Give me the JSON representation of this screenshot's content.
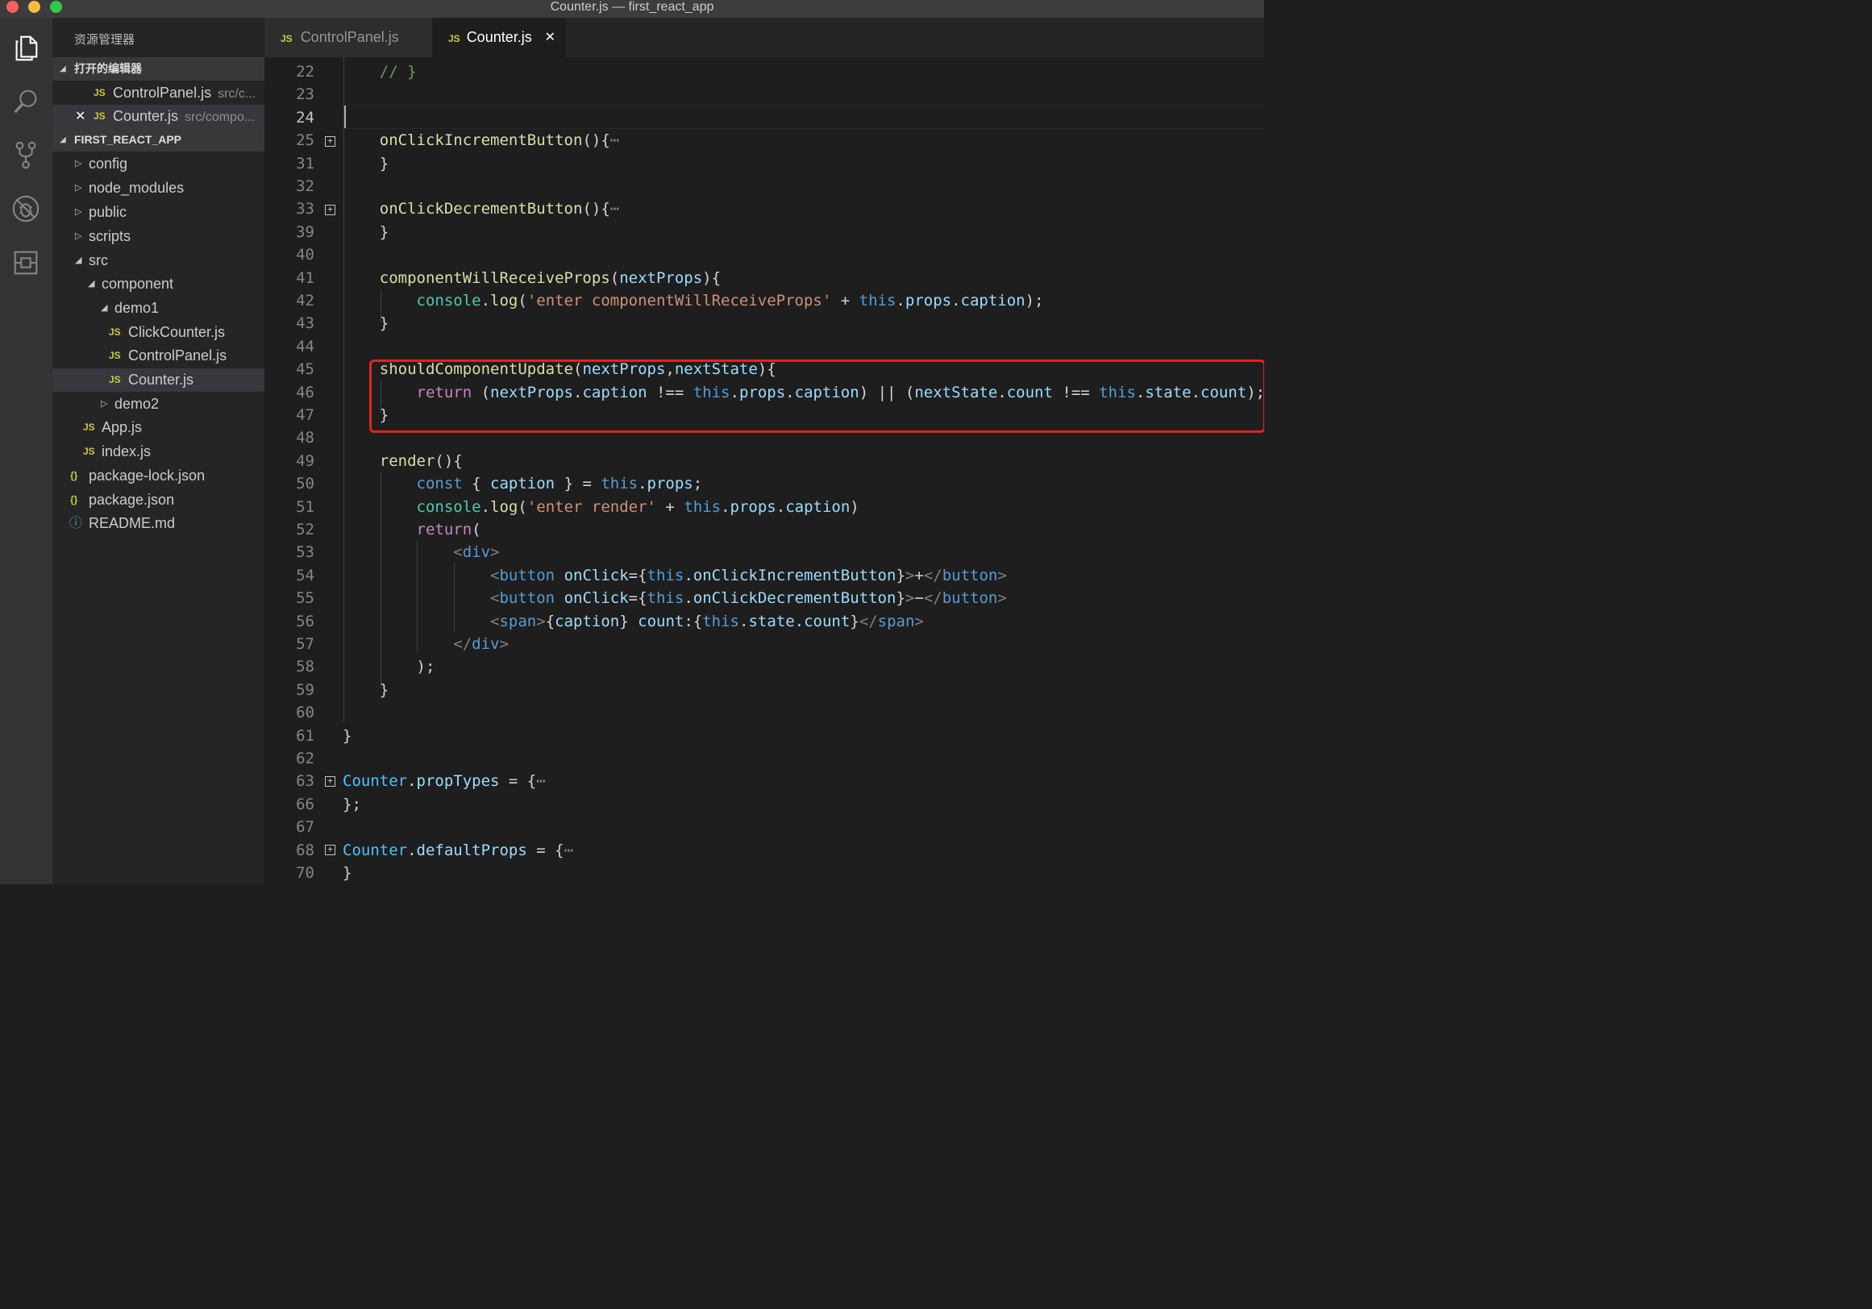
{
  "window": {
    "title": "Counter.js — first_react_app"
  },
  "activity_bar": [
    "files-icon",
    "search-icon",
    "source-control-icon",
    "debug-icon",
    "extensions-icon"
  ],
  "sidebar": {
    "title": "资源管理器",
    "open_editors": {
      "header": "打开的编辑器",
      "items": [
        {
          "name": "ControlPanel.js",
          "path": "src/c..."
        },
        {
          "name": "Counter.js",
          "path": "src/compo..."
        }
      ]
    },
    "project": {
      "header": "FIRST_REACT_APP",
      "items": [
        "config",
        "node_modules",
        "public",
        "scripts",
        "src",
        "component",
        "demo1",
        "ClickCounter.js",
        "ControlPanel.js",
        "Counter.js",
        "demo2",
        "App.js",
        "index.js",
        "package-lock.json",
        "package.json",
        "README.md"
      ]
    }
  },
  "tabs": [
    {
      "label": "ControlPanel.js",
      "icon": "JS"
    },
    {
      "label": "Counter.js",
      "icon": "JS"
    }
  ],
  "editor": {
    "line_numbers": [
      "22",
      "23",
      "24",
      "25",
      "31",
      "32",
      "33",
      "39",
      "40",
      "41",
      "42",
      "43",
      "44",
      "45",
      "46",
      "47",
      "48",
      "49",
      "50",
      "51",
      "52",
      "53",
      "54",
      "55",
      "56",
      "57",
      "58",
      "59",
      "60",
      "61",
      "62",
      "63",
      "66",
      "67",
      "68",
      "70"
    ],
    "current_line": "24",
    "code_lines": [
      "    // }",
      "",
      "",
      "    onClickIncrementButton(){⋯",
      "    }",
      "",
      "    onClickDecrementButton(){⋯",
      "    }",
      "",
      "    componentWillReceiveProps(nextProps){",
      "        console.log('enter componentWillReceiveProps' + this.props.caption);",
      "    }",
      "",
      "    shouldComponentUpdate(nextProps,nextState){",
      "        return (nextProps.caption !== this.props.caption) || (nextState.count !== this.state.count);",
      "    }",
      "",
      "    render(){",
      "        const { caption } = this.props;",
      "        console.log('enter render' + this.props.caption)",
      "        return(",
      "            <div>",
      "                <button onClick={this.onClickIncrementButton}>+</button>",
      "                <button onClick={this.onClickDecrementButton}>−</button>",
      "                <span>{caption} count:{this.state.count}</span>",
      "            </div>",
      "        );",
      "    }",
      "",
      "}",
      "",
      "Counter.propTypes = {⋯",
      "};",
      "",
      "Counter.defaultProps = {⋯",
      "}"
    ],
    "highlight_box_color": "#e0251f"
  }
}
